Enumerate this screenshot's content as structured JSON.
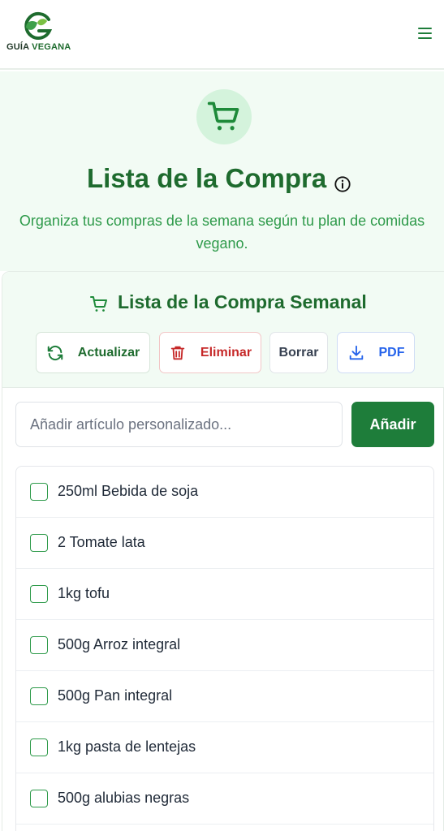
{
  "header": {
    "logo_word1": "GUÍA",
    "logo_word2": " VEGANA",
    "menu_icon": "hamburger-menu-icon"
  },
  "hero": {
    "icon": "shopping-cart-icon",
    "title": "Lista de la Compra",
    "info_icon": "info-icon",
    "subtitle_line1": "Organiza tus compras de la semana según tu plan de comidas",
    "subtitle_line2": "vegano."
  },
  "card": {
    "title": "Lista de la Compra Semanal",
    "buttons": {
      "update": "Actualizar",
      "delete": "Eliminar",
      "clear": "Borrar",
      "pdf": "PDF"
    },
    "input_placeholder": "Añadir artículo personalizado...",
    "add_label": "Añadir",
    "items": [
      {
        "label": "250ml Bebida de soja",
        "checked": false
      },
      {
        "label": "2 Tomate lata",
        "checked": false
      },
      {
        "label": "1kg tofu",
        "checked": false
      },
      {
        "label": "500g Arroz integral",
        "checked": false
      },
      {
        "label": "500g Pan integral",
        "checked": false
      },
      {
        "label": "1kg pasta de lentejas",
        "checked": false
      },
      {
        "label": "500g alubias negras",
        "checked": false
      }
    ]
  },
  "colors": {
    "brand_green": "#1e7d3a",
    "title_green": "#1e6b2e",
    "light_green_bg": "#f2fbf4",
    "danger": "#c62828",
    "pdf_blue": "#2563eb"
  }
}
